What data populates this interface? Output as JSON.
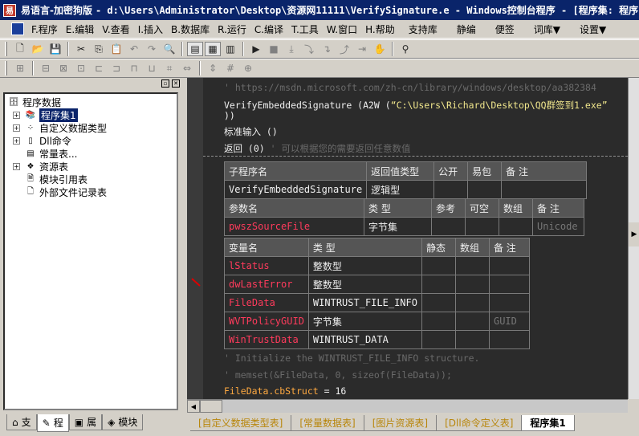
{
  "window": {
    "app_name": "易语言-加密狗版",
    "path_title": "- d:\\Users\\Administrator\\Desktop\\资源网11111\\VerifySignature.e - Windows控制台程序 - [程序集: 程序"
  },
  "menu": {
    "items": [
      "F.程序",
      "E.编辑",
      "V.查看",
      "I.插入",
      "B.数据库",
      "R.运行",
      "C.编译",
      "T.工具",
      "W.窗口",
      "H.帮助"
    ],
    "extra": [
      "支持库",
      "静编",
      "便签",
      "词库▼",
      "设置▼"
    ]
  },
  "tree": {
    "root": "程序数据",
    "items": [
      {
        "label": "程序集1",
        "expander": "+",
        "icon": "module-icon",
        "selected": true
      },
      {
        "label": "自定义数据类型",
        "expander": "+",
        "icon": "datatype-icon",
        "selected": false
      },
      {
        "label": "Dll命令",
        "expander": "+",
        "icon": "dll-icon",
        "selected": false
      },
      {
        "label": "常量表...",
        "expander": "",
        "icon": "constant-icon",
        "selected": false
      },
      {
        "label": "资源表",
        "expander": "+",
        "icon": "resource-icon",
        "selected": false
      },
      {
        "label": "模块引用表",
        "expander": "",
        "icon": "module-ref-icon",
        "selected": false
      },
      {
        "label": "外部文件记录表",
        "expander": "",
        "icon": "file-icon",
        "selected": false
      }
    ]
  },
  "left_tabs": [
    "支",
    "程",
    "属",
    "模块"
  ],
  "code": {
    "comment_url": "' https://msdn.microsoft.com/zh-cn/library/windows/desktop/aa382384",
    "call_prefix": "VerifyEmbeddedSignature (A2W (",
    "call_string": "“C:\\Users\\Richard\\Desktop\\QQ群签到1.exe”",
    "call_close": "))",
    "stdin": "标准输入 ()",
    "return_code": "返回 (0)",
    "return_comment": "' 可以根据您的需要返回任意数值",
    "comment_init": "' Initialize the WINTRUST_FILE_INFO structure.",
    "comment_memset": "' memset(&FileData, 0, sizeof(FileData));",
    "assign_var": "FileData",
    "assign_field": ".cbStruct",
    "assign_rest": " = 16"
  },
  "sub_table": {
    "headers": [
      "子程序名",
      "返回值类型",
      "公开",
      "易包",
      "备 注"
    ],
    "row": [
      "VerifyEmbeddedSignature",
      "逻辑型",
      "",
      "",
      ""
    ]
  },
  "param_table": {
    "headers": [
      "参数名",
      "类 型",
      "参考",
      "可空",
      "数组",
      "备 注"
    ],
    "rows": [
      [
        "pwszSourceFile",
        "字节集",
        "",
        "",
        "",
        "Unicode"
      ]
    ]
  },
  "var_table": {
    "headers": [
      "变量名",
      "类 型",
      "静态",
      "数组",
      "备 注"
    ],
    "rows": [
      [
        "lStatus",
        "整数型",
        "",
        "",
        ""
      ],
      [
        "dwLastError",
        "整数型",
        "",
        "",
        ""
      ],
      [
        "FileData",
        "WINTRUST_FILE_INFO",
        "",
        "",
        ""
      ],
      [
        "WVTPolicyGUID",
        "字节集",
        "",
        "",
        "GUID"
      ],
      [
        "WinTrustData",
        "WINTRUST_DATA",
        "",
        "",
        ""
      ]
    ]
  },
  "bottom_tabs": [
    {
      "label": "[自定义数据类型表]",
      "active": false
    },
    {
      "label": "[常量数据表]",
      "active": false
    },
    {
      "label": "[图片资源表]",
      "active": false
    },
    {
      "label": "[Dll命令定义表]",
      "active": false
    },
    {
      "label": "程序集1",
      "active": true
    }
  ],
  "colors": {
    "code_bg": "#2b2b2b",
    "title_bg": "#0a246a",
    "param_name": "#ff3b5c",
    "string": "#f0e68c",
    "comment": "#6a6a6a"
  }
}
